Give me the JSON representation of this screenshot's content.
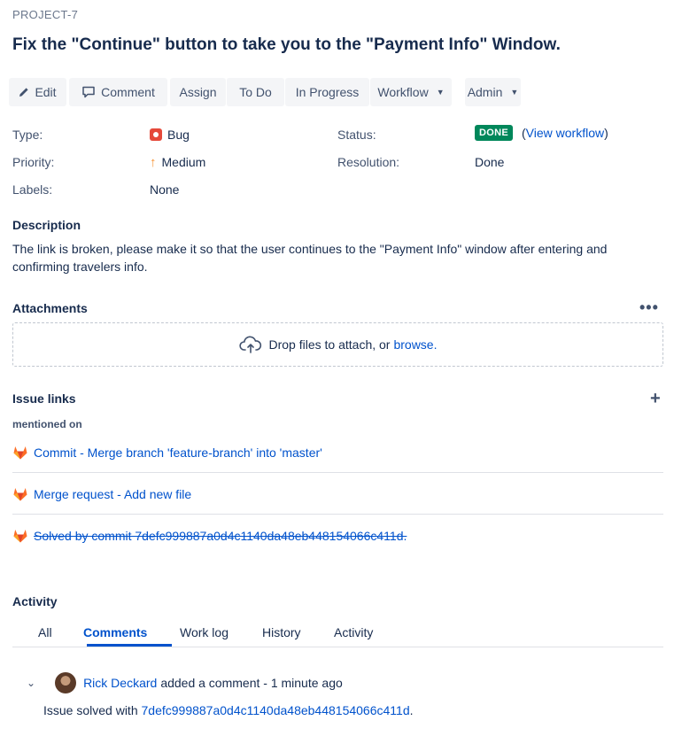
{
  "issue": {
    "key": "PROJECT-7",
    "title": "Fix the \"Continue\" button to take you to the \"Payment Info\" Window."
  },
  "toolbar": {
    "edit": "Edit",
    "comment": "Comment",
    "assign": "Assign",
    "todo": "To Do",
    "in_progress": "In Progress",
    "workflow": "Workflow",
    "admin": "Admin"
  },
  "fields": {
    "type_label": "Type:",
    "type_value": "Bug",
    "priority_label": "Priority:",
    "priority_value": "Medium",
    "labels_label": "Labels:",
    "labels_value": "None",
    "status_label": "Status:",
    "status_value": "DONE",
    "view_workflow": "View workflow",
    "resolution_label": "Resolution:",
    "resolution_value": "Done",
    "status_color": "#00875a",
    "bug_color": "#e5493a",
    "priority_color": "#f79232"
  },
  "description": {
    "heading": "Description",
    "text": "The link is broken, please make it so that the user continues to the \"Payment Info\" window after entering and confirming travelers info."
  },
  "attachments": {
    "heading": "Attachments",
    "drop_text": "Drop files to attach, or",
    "browse": "browse."
  },
  "issue_links": {
    "heading": "Issue links",
    "subheading": "mentioned on",
    "items": [
      {
        "label": "Commit - Merge branch 'feature-branch' into 'master'",
        "icon": "gitlab-icon"
      },
      {
        "label": "Merge request - Add new file",
        "icon": "gitlab-icon"
      },
      {
        "label": "Solved by commit 7defc999887a0d4c1140da48eb448154066c411d.",
        "icon": "gitlab-icon",
        "resolved": true
      }
    ]
  },
  "activity": {
    "heading": "Activity",
    "tabs": [
      "All",
      "Comments",
      "Work log",
      "History",
      "Activity"
    ],
    "active_tab": "Comments"
  },
  "comment": {
    "author": "Rick Deckard",
    "action": "added a comment - 1 minute ago",
    "body_prefix": "Issue solved with",
    "commit": "7defc999887a0d4c1140da48eb448154066c411d",
    "body_suffix": "."
  }
}
